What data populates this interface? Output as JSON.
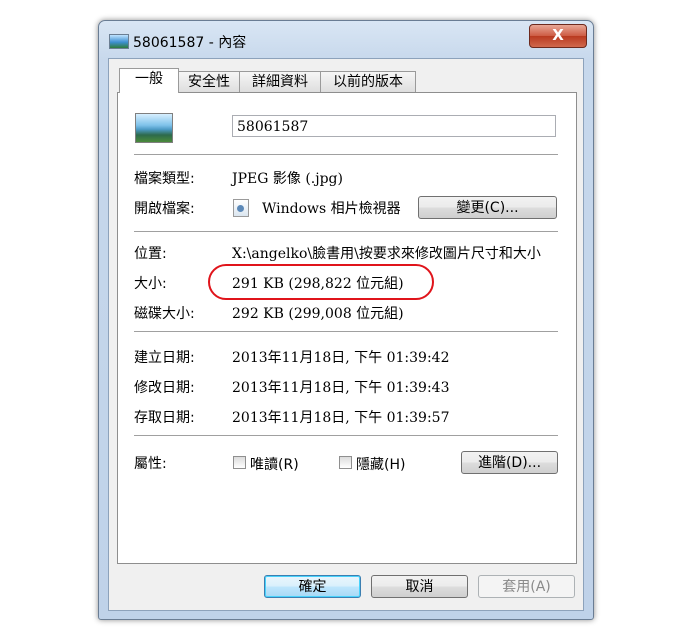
{
  "window": {
    "title": "58061587 - 內容",
    "close_label": "X"
  },
  "tabs": [
    {
      "label": "一般",
      "active": true
    },
    {
      "label": "安全性",
      "active": false
    },
    {
      "label": "詳細資料",
      "active": false
    },
    {
      "label": "以前的版本",
      "active": false
    }
  ],
  "general": {
    "file_name": "58061587",
    "file_type_label": "檔案類型:",
    "file_type_value": "JPEG 影像 (.jpg)",
    "opens_with_label": "開啟檔案:",
    "opens_with_value": "Windows 相片檢視器",
    "change_button": "變更(C)...",
    "location_label": "位置:",
    "location_value": "X:\\angelko\\臉書用\\按要求來修改圖片尺寸和大小",
    "size_label": "大小:",
    "size_value": "291 KB (298,822 位元組)",
    "size_on_disk_label": "磁碟大小:",
    "size_on_disk_value": "292 KB (299,008 位元組)",
    "created_label": "建立日期:",
    "created_value": "2013年11月18日, 下午 01:39:42",
    "modified_label": "修改日期:",
    "modified_value": "2013年11月18日, 下午 01:39:43",
    "accessed_label": "存取日期:",
    "accessed_value": "2013年11月18日, 下午 01:39:57",
    "attributes_label": "屬性:",
    "readonly_label": "唯讀(R)",
    "hidden_label": "隱藏(H)",
    "advanced_button": "進階(D)..."
  },
  "footer": {
    "ok": "確定",
    "cancel": "取消",
    "apply": "套用(A)"
  },
  "highlight_color": "#e0141b"
}
